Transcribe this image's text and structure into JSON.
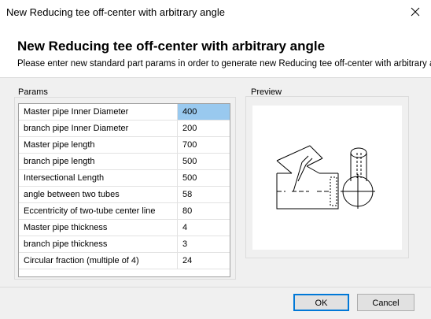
{
  "window": {
    "title": "New Reducing tee off-center with arbitrary angle"
  },
  "header": {
    "title": "New Reducing tee off-center with arbitrary angle",
    "subtitle": "Please enter new standard part params in order to generate new Reducing tee off-center with arbitrary angle"
  },
  "params": {
    "group_label": "Params",
    "rows": [
      {
        "name": "Master pipe Inner Diameter",
        "value": "400"
      },
      {
        "name": "branch pipe Inner Diameter",
        "value": "200"
      },
      {
        "name": "Master pipe length",
        "value": "700"
      },
      {
        "name": "branch pipe length",
        "value": "500"
      },
      {
        "name": "Intersectional Length",
        "value": "500"
      },
      {
        "name": "angle between two tubes",
        "value": "58"
      },
      {
        "name": "Eccentricity of two-tube center line",
        "value": "80"
      },
      {
        "name": "Master pipe thickness",
        "value": "4"
      },
      {
        "name": "branch pipe thickness",
        "value": "3"
      },
      {
        "name": "Circular fraction (multiple of 4)",
        "value": "24"
      }
    ]
  },
  "preview": {
    "group_label": "Preview"
  },
  "buttons": {
    "ok": "OK",
    "cancel": "Cancel"
  }
}
